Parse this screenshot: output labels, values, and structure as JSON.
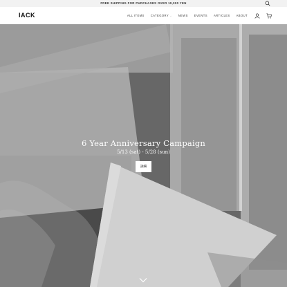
{
  "announcement": "FREE SHIPPING FOR PURCHASES OVER 10,000 YEN",
  "header": {
    "logo": "IACK",
    "nav": [
      {
        "label": "ALL ITEMS"
      },
      {
        "label": "CATEGORY",
        "has_dropdown": true
      },
      {
        "label": "NEWS"
      },
      {
        "label": "EVENTS"
      },
      {
        "label": "ARTICLES"
      },
      {
        "label": "ABOUT"
      }
    ],
    "icons": [
      "search-icon",
      "account-icon",
      "cart-icon"
    ]
  },
  "hero": {
    "title": "6 Year Anniversary Campaign",
    "dates": "5/13 (sat) - 5/28 (sun)",
    "button_label": "詳細"
  },
  "colors": {
    "text": "#222222",
    "announcement_bg": "#f2f2f2",
    "button_bg": "#ffffff"
  }
}
